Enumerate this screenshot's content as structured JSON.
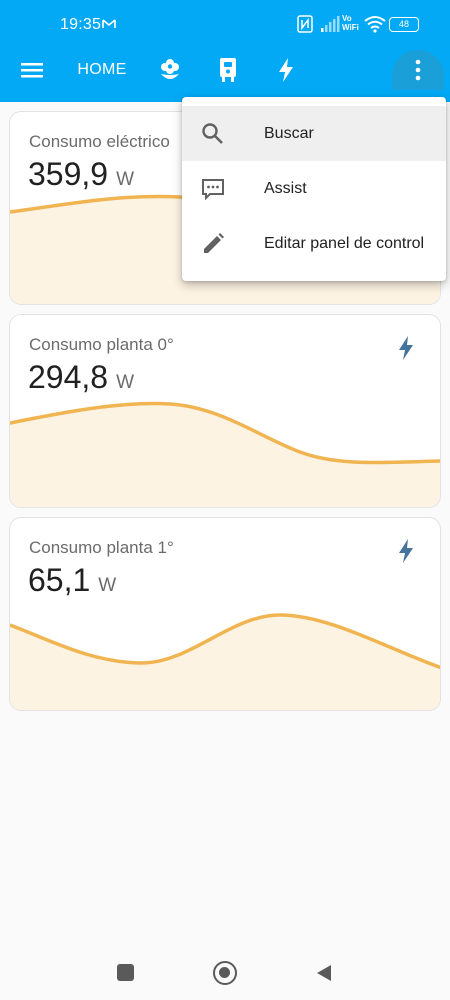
{
  "status_bar": {
    "time": "19:35",
    "network_label": "Vo WiFi",
    "vowifi_top": "Vo",
    "vowifi_bottom": "WiFi",
    "battery": "48"
  },
  "toolbar": {
    "menu_icon": "hamburger-menu-icon",
    "tab_home_label": "HOME",
    "tab_icons": [
      "flower-icon",
      "device-icon",
      "lightning-icon"
    ],
    "overflow_icon": "more-vertical-icon",
    "background": "#03a9f4"
  },
  "cards": [
    {
      "name": "Consumo eléctrico",
      "value": "359,9",
      "unit": "W",
      "icon": "lightning-icon"
    },
    {
      "name": "Consumo planta 0°",
      "value": "294,8",
      "unit": "W",
      "icon": "lightning-icon"
    },
    {
      "name": "Consumo planta 1°",
      "value": "65,1",
      "unit": "W",
      "icon": "lightning-icon"
    }
  ],
  "overflow_menu": {
    "items": [
      {
        "label": "Buscar",
        "icon": "search-icon"
      },
      {
        "label": "Assist",
        "icon": "assist-chat-icon"
      },
      {
        "label": "Editar panel de control",
        "icon": "pencil-icon"
      }
    ]
  },
  "colors": {
    "accent": "#03a9f4",
    "graph_line": "#f0b450",
    "graph_fill": "#fdf3e3",
    "energy_icon": "#44739e"
  },
  "nav_bar": {
    "icons": [
      "recent-apps-icon",
      "home-icon",
      "back-icon"
    ]
  }
}
